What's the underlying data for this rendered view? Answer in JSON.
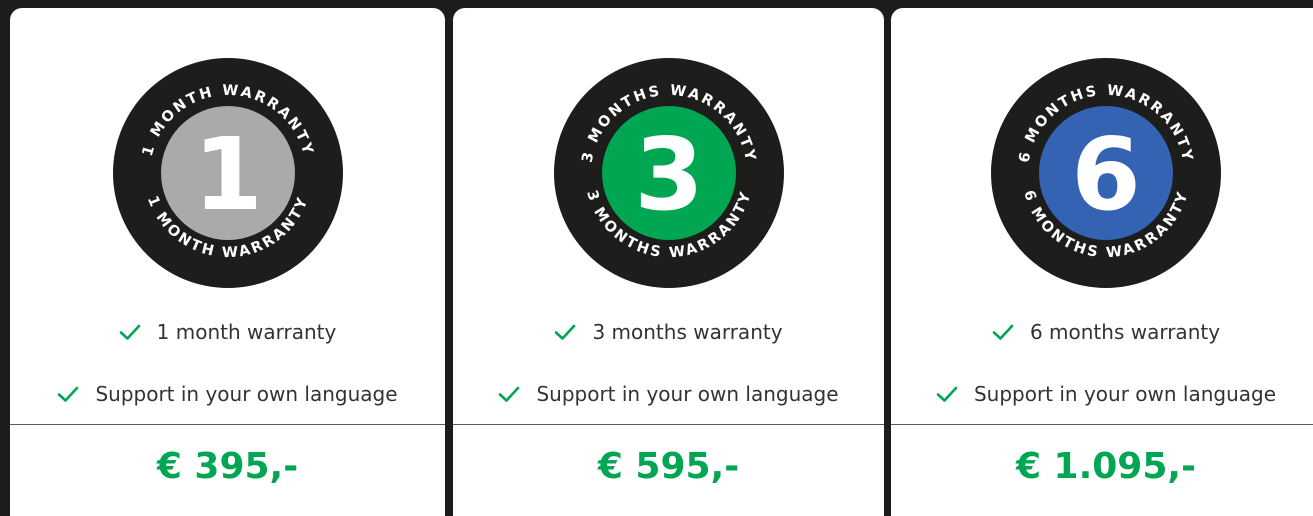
{
  "accent_color": "#00a651",
  "plans": [
    {
      "badge_number": "1",
      "badge_ring_text": "1 MONTH WARRANTY",
      "badge_color": "#a9aaa9",
      "features": [
        "1 month warranty",
        "Support in your own language"
      ],
      "price": "€ 395,-"
    },
    {
      "badge_number": "3",
      "badge_ring_text": "3 MONTHS WARRANTY",
      "badge_color": "#00a651",
      "features": [
        "3 months warranty",
        "Support in your own language"
      ],
      "price": "€ 595,-"
    },
    {
      "badge_number": "6",
      "badge_ring_text": "6 MONTHS WARRANTY",
      "badge_color": "#3563b4",
      "features": [
        "6 months warranty",
        "Support in your own language"
      ],
      "price": "€ 1.095,-"
    }
  ],
  "icons": {
    "feature": "check-icon",
    "badge": "warranty-badge-icon"
  }
}
